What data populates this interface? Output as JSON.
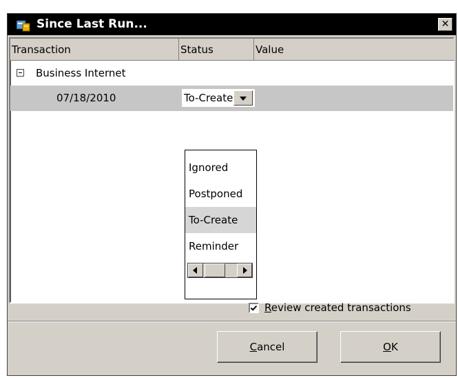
{
  "window": {
    "title": "Since Last Run...",
    "close_glyph": "✕"
  },
  "columns": [
    "Transaction",
    "Status",
    "Value"
  ],
  "group": {
    "label": "Business Internet",
    "expander_glyph": "−"
  },
  "row": {
    "date": "07/18/2010",
    "status": "To-Create",
    "value": ""
  },
  "status_options": [
    "Ignored",
    "Postponed",
    "To-Create",
    "Reminder"
  ],
  "review": {
    "checked": true,
    "accel": "R",
    "rest": "eview created transactions"
  },
  "buttons": {
    "cancel_accel": "C",
    "cancel_rest": "ancel",
    "ok_accel": "O",
    "ok_rest": "K"
  },
  "icons": {
    "app": "gnucash-app-icon",
    "close": "close-icon",
    "check": "check-icon",
    "expander": "collapse-icon",
    "dropdown": "chevron-down-icon",
    "scroll_left": "arrow-left-icon",
    "scroll_right": "arrow-right-icon"
  }
}
